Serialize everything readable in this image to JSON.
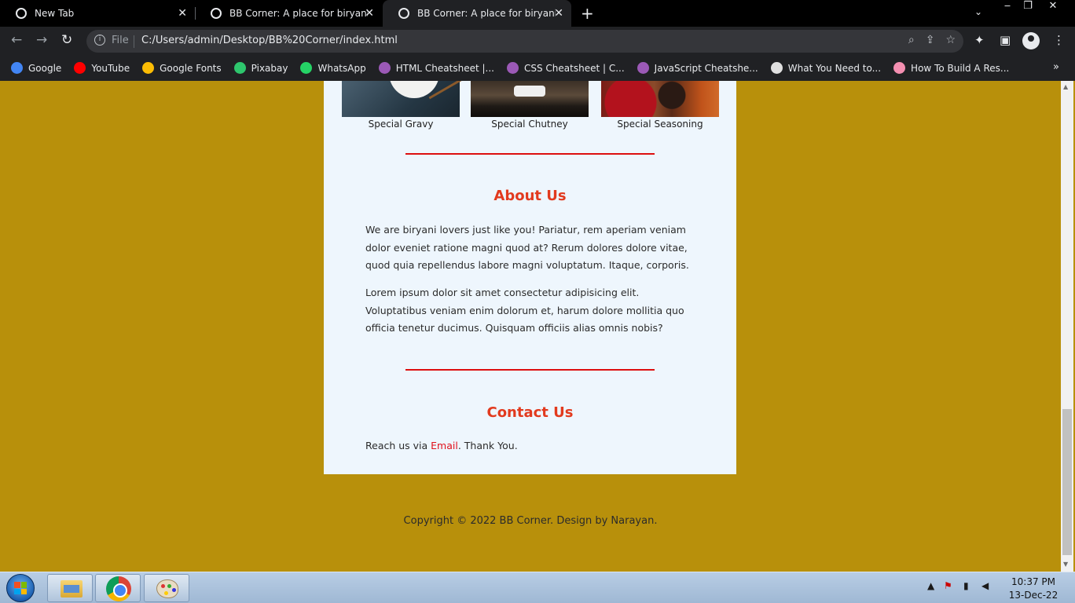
{
  "browser": {
    "tabs": [
      {
        "title": "New Tab",
        "active": false
      },
      {
        "title": "BB Corner: A place for biryani lov",
        "active": false
      },
      {
        "title": "BB Corner: A place for biryani lov",
        "active": true
      }
    ],
    "address": {
      "scheme_label": "File",
      "url": "C:/Users/admin/Desktop/BB%20Corner/index.html"
    },
    "bookmarks": [
      {
        "label": "Google",
        "icon": "google-icon",
        "color": "#4285f4"
      },
      {
        "label": "YouTube",
        "icon": "youtube-icon",
        "color": "#ff0000"
      },
      {
        "label": "Google Fonts",
        "icon": "google-fonts-icon",
        "color": "#fbbc04"
      },
      {
        "label": "Pixabay",
        "icon": "pixabay-icon",
        "color": "#2ec66d"
      },
      {
        "label": "WhatsApp",
        "icon": "whatsapp-icon",
        "color": "#25d366"
      },
      {
        "label": "HTML Cheatsheet |...",
        "icon": "avatar-icon",
        "color": "#9b59b6"
      },
      {
        "label": "CSS Cheatsheet | C...",
        "icon": "avatar-icon",
        "color": "#9b59b6"
      },
      {
        "label": "JavaScript Cheatshe...",
        "icon": "avatar-icon",
        "color": "#9b59b6"
      },
      {
        "label": "What You Need to...",
        "icon": "site-icon",
        "color": "#e0e0e0"
      },
      {
        "label": "How To Build A Res...",
        "icon": "site-icon",
        "color": "#f48fb1"
      }
    ]
  },
  "page": {
    "gallery": [
      {
        "caption": "Special Gravy"
      },
      {
        "caption": "Special Chutney"
      },
      {
        "caption": "Special Seasoning"
      }
    ],
    "about": {
      "title": "About Us",
      "paragraphs": [
        "We are biryani lovers just like you! Pariatur, rem aperiam veniam dolor eveniet ratione magni quod at? Rerum dolores dolore vitae, quod quia repellendus labore magni voluptatum. Itaque, corporis.",
        "Lorem ipsum dolor sit amet consectetur adipisicing elit. Voluptatibus veniam enim dolorum et, harum dolore mollitia quo officia tenetur ducimus. Quisquam officiis alias omnis nobis?"
      ]
    },
    "contact": {
      "title": "Contact Us",
      "prefix": "Reach us via ",
      "link": "Email",
      "suffix": ". Thank You."
    },
    "footer": "Copyright © 2022 BB Corner. Design by Narayan.",
    "colors": {
      "background": "#b8900b",
      "accent": "#e23a1e",
      "card": "#eef6fd"
    }
  },
  "taskbar": {
    "time": "10:37 PM",
    "date": "13-Dec-22",
    "apps": [
      "windows-explorer-icon",
      "chrome-icon",
      "paint-icon"
    ]
  }
}
